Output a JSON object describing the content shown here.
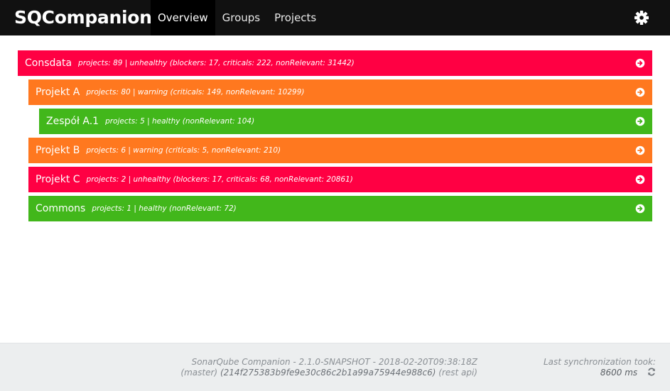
{
  "app": {
    "brand": "SQCompanion",
    "nav": [
      {
        "label": "Overview",
        "active": true
      },
      {
        "label": "Groups",
        "active": false
      },
      {
        "label": "Projects",
        "active": false
      }
    ],
    "settings_icon": "gear-icon"
  },
  "colors": {
    "unhealthy": "#ff0043",
    "warning": "#ff781f",
    "healthy": "#42b71b",
    "navbar": "#111111"
  },
  "groups": [
    {
      "name": "Consdata",
      "summary": "projects: 89 | unhealthy (blockers: 17, criticals: 222, nonRelevant: 31442)",
      "status": "unhealthy",
      "level": 0
    },
    {
      "name": "Projekt A",
      "summary": "projects: 80 | warning (criticals: 149, nonRelevant: 10299)",
      "status": "warning",
      "level": 1
    },
    {
      "name": "Zespół A.1",
      "summary": "projects: 5 | healthy (nonRelevant: 104)",
      "status": "healthy",
      "level": 2
    },
    {
      "name": "Projekt B",
      "summary": "projects: 6 | warning (criticals: 5, nonRelevant: 210)",
      "status": "warning",
      "level": 1
    },
    {
      "name": "Projekt C",
      "summary": "projects: 2 | unhealthy (blockers: 17, criticals: 68, nonRelevant: 20861)",
      "status": "unhealthy",
      "level": 1
    },
    {
      "name": "Commons",
      "summary": "projects: 1 | healthy (nonRelevant: 72)",
      "status": "healthy",
      "level": 1
    }
  ],
  "footer": {
    "version_line": "SonarQube Companion - 2.1.0-SNAPSHOT - 2018-02-20T09:38:18Z",
    "branch": "(master)",
    "commit": "(214f275383b9fe9e30c86c2b1a99a75944e988c6)",
    "api": "(rest api)",
    "sync_label": "Last synchronization took:",
    "sync_value": "8600 ms",
    "refresh_icon": "refresh-icon"
  }
}
